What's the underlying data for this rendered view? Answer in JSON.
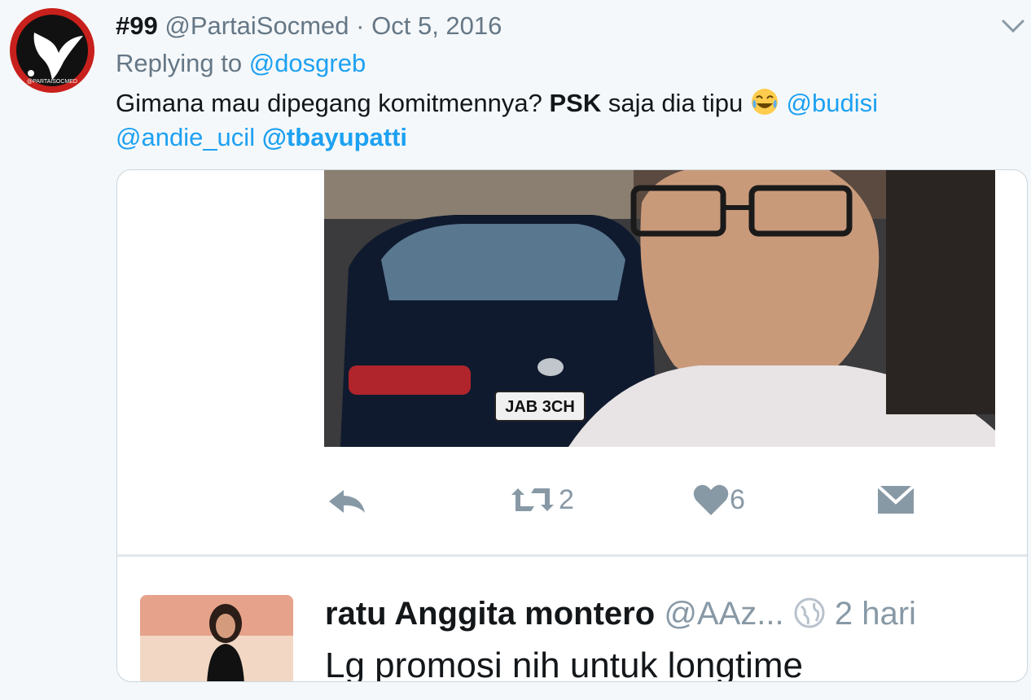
{
  "tweet": {
    "number": "#99",
    "handle": "@PartaiSocmed",
    "separator": "·",
    "date": "Oct 5, 2016",
    "replying_prefix": "Replying to",
    "replying_to": "@dosgreb",
    "text_part1": "Gimana mau dipegang komitmennya? ",
    "text_bold": "PSK",
    "text_part2": " saja dia tipu ",
    "mention1": "@budisi",
    "mention2": "@andie_ucil",
    "mention3": "@tbayupatti",
    "avatar_text": "@PARTAISOCMED"
  },
  "embedded": {
    "photo_plate": "JAB 3CH",
    "retweet_count": "2",
    "like_count": "6",
    "quote_name": "ratu Anggita montero",
    "quote_handle": "@AAz...",
    "quote_time": "2 hari",
    "quote_text": "Lg promosi nih untuk longtime"
  },
  "colors": {
    "link": "#1da1f2",
    "muted": "#657786",
    "avatar_red": "#c8201c"
  },
  "icons": [
    "chevron-down-icon",
    "reply-icon",
    "retweet-icon",
    "heart-icon",
    "message-icon",
    "globe-icon",
    "laughing-emoji-icon"
  ]
}
